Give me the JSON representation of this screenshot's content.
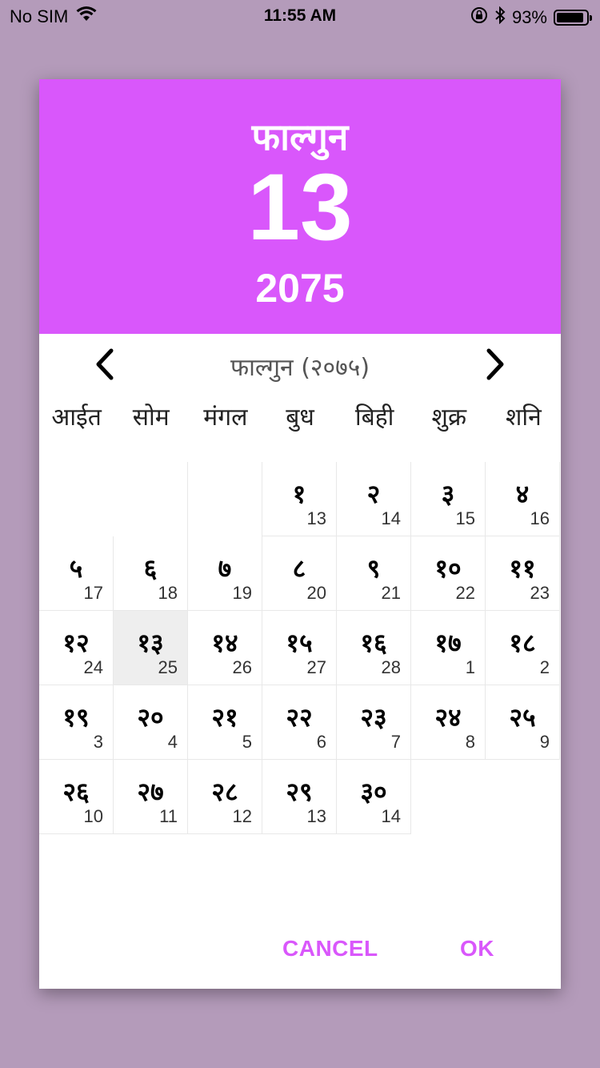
{
  "status_bar": {
    "carrier": "No SIM",
    "time": "11:55 AM",
    "battery": "93%",
    "battery_level": 0.93,
    "icons": [
      "wifi-icon",
      "rotation-lock-icon",
      "bluetooth-icon",
      "battery-icon"
    ]
  },
  "header": {
    "month": "फाल्गुन",
    "day": "13",
    "year": "2075",
    "background": "#d957fb"
  },
  "nav": {
    "title": "फाल्गुन (२०७५)",
    "prev_icon": "chevron-left-icon",
    "next_icon": "chevron-right-icon"
  },
  "weekdays": [
    "आईत",
    "सोम",
    "मंगल",
    "बुध",
    "बिही",
    "शुक्र",
    "शनि"
  ],
  "calendar": {
    "leading_blanks": 3,
    "selected_day": "१३",
    "days": [
      {
        "np": "१",
        "en": "13"
      },
      {
        "np": "२",
        "en": "14"
      },
      {
        "np": "३",
        "en": "15"
      },
      {
        "np": "४",
        "en": "16"
      },
      {
        "np": "५",
        "en": "17"
      },
      {
        "np": "६",
        "en": "18"
      },
      {
        "np": "७",
        "en": "19"
      },
      {
        "np": "८",
        "en": "20"
      },
      {
        "np": "९",
        "en": "21"
      },
      {
        "np": "१०",
        "en": "22"
      },
      {
        "np": "११",
        "en": "23"
      },
      {
        "np": "१२",
        "en": "24"
      },
      {
        "np": "१३",
        "en": "25"
      },
      {
        "np": "१४",
        "en": "26"
      },
      {
        "np": "१५",
        "en": "27"
      },
      {
        "np": "१६",
        "en": "28"
      },
      {
        "np": "१७",
        "en": "1"
      },
      {
        "np": "१८",
        "en": "2"
      },
      {
        "np": "१९",
        "en": "3"
      },
      {
        "np": "२०",
        "en": "4"
      },
      {
        "np": "२१",
        "en": "5"
      },
      {
        "np": "२२",
        "en": "6"
      },
      {
        "np": "२३",
        "en": "7"
      },
      {
        "np": "२४",
        "en": "8"
      },
      {
        "np": "२५",
        "en": "9"
      },
      {
        "np": "२६",
        "en": "10"
      },
      {
        "np": "२७",
        "en": "11"
      },
      {
        "np": "२८",
        "en": "12"
      },
      {
        "np": "२९",
        "en": "13"
      },
      {
        "np": "३०",
        "en": "14"
      }
    ]
  },
  "actions": {
    "cancel_label": "CANCEL",
    "ok_label": "OK",
    "accent": "#d957fb"
  }
}
